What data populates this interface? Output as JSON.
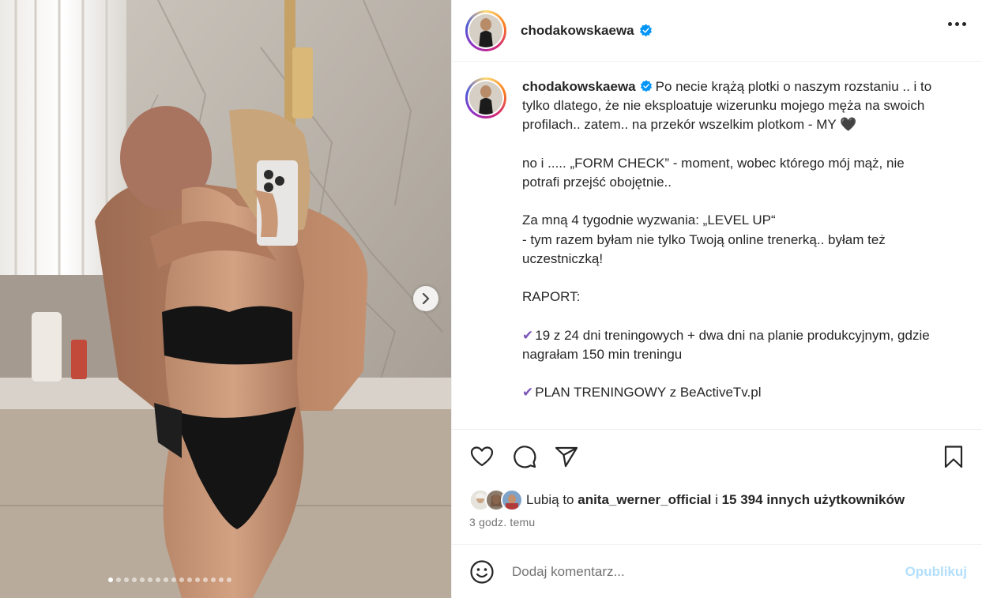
{
  "post": {
    "username": "chodakowskaewa",
    "verified": true,
    "carousel": {
      "total_slides": 16,
      "current_slide": 1
    },
    "caption": {
      "username": "chodakowskaewa",
      "p1": "Po necie krążą plotki o naszym rozstaniu .. i to tylko dlatego, że nie eksploatuje wizerunku mojego męża na swoich profilach.. zatem.. na przekór wszelkim plotkom - MY ",
      "p1_emoji": "🖤",
      "p2": "no i ..... „FORM CHECK” - moment, wobec którego mój mąż, nie potrafi przejść obojętnie..",
      "p3_line1": "Za mną 4 tygodnie wyzwania: „LEVEL UP“",
      "p3_line2": "- tym razem byłam nie tylko Twoją online trenerką.. byłam też uczestniczką!",
      "p4": "RAPORT:",
      "p5_check": "✔",
      "p5": "19 z 24 dni treningowych + dwa dni na planie produkcyjnym, gdzie nagrałam 150 min treningu",
      "p6_check": "✔",
      "p6": "PLAN TRENINGOWY z BeActiveTv.pl"
    },
    "likes": {
      "prefix": "Lubią to ",
      "first_user": "anita_werner_official",
      "joiner": " i ",
      "others": "15 394 innych użytkowników"
    },
    "time_ago": "3 godz. temu",
    "comment": {
      "placeholder": "Dodaj komentarz...",
      "value": "",
      "publish_label": "Opublikuj"
    }
  },
  "icons": {
    "like": "heart-icon",
    "comment": "comment-bubble-icon",
    "share": "paper-plane-icon",
    "save": "bookmark-icon",
    "emoji": "smiley-icon",
    "next": "chevron-right-icon",
    "more": "ellipsis-icon",
    "verified": "verified-badge-icon"
  },
  "colors": {
    "verified": "#0095f6",
    "publish_disabled": "#b2dffc",
    "check_emoji": "#7c56b8",
    "text": "#262626",
    "muted": "#737373"
  }
}
